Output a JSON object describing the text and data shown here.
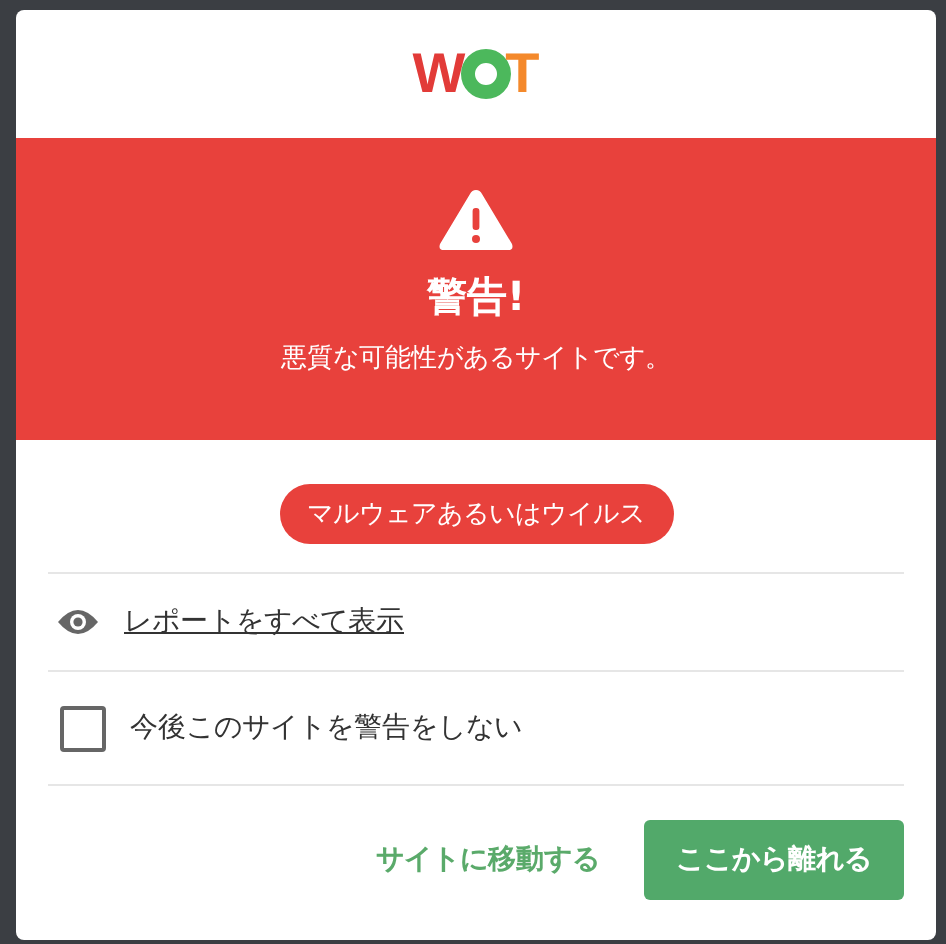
{
  "logo": {
    "left": "W",
    "right": "T"
  },
  "alert": {
    "title": "警告!",
    "message": "悪質な可能性があるサイトです。"
  },
  "category_badge": "マルウェアあるいはウイルス",
  "report_link": "レポートをすべて表示",
  "dont_warn": {
    "label": "今後このサイトを警告をしない",
    "checked": false
  },
  "buttons": [
    {
      "kind": "link",
      "label": "サイトに移動する"
    },
    {
      "kind": "primary",
      "label": "ここから離れる"
    }
  ]
}
